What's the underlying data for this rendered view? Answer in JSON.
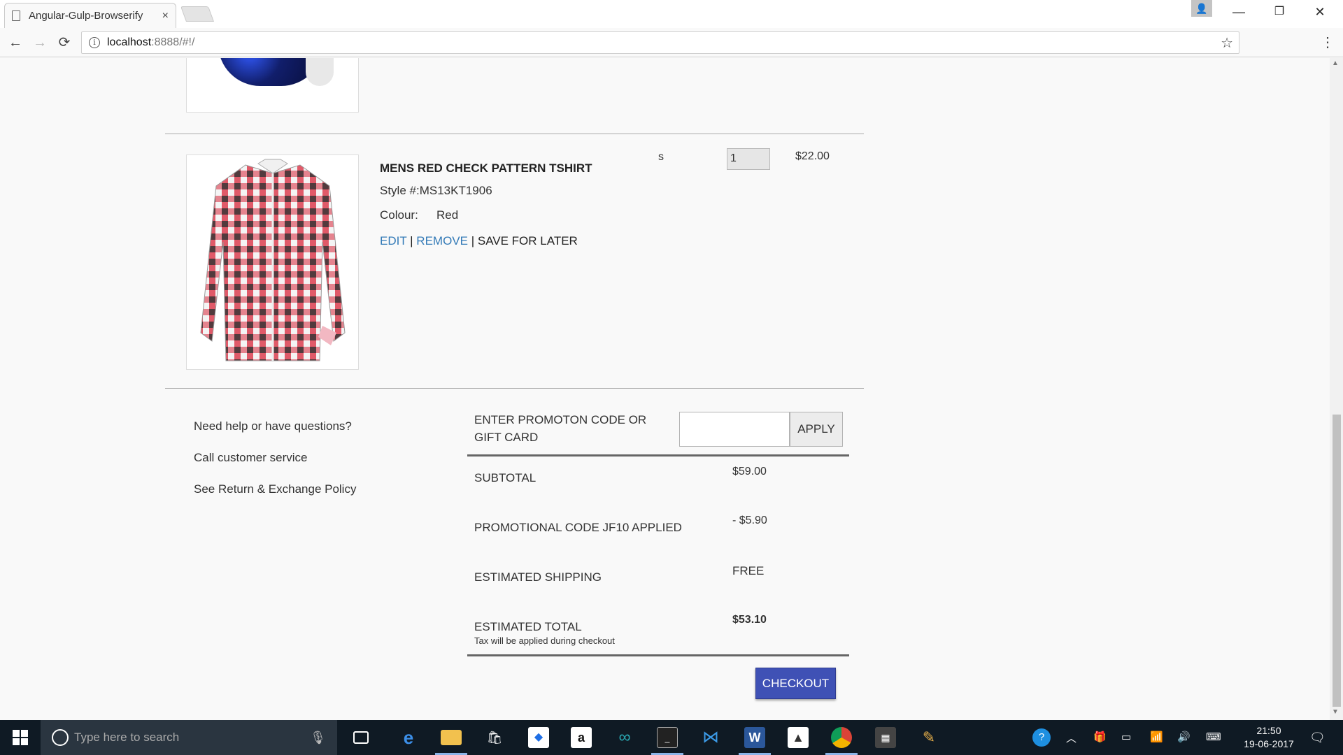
{
  "browser": {
    "tab_title": "Angular-Gulp-Browserify",
    "tab_close": "×",
    "url_host": "localhost",
    "url_rest": ":8888/#!/",
    "info_glyph": "i",
    "back_glyph": "←",
    "forward_glyph": "→",
    "reload_glyph": "⟳",
    "star_glyph": "☆",
    "menu_glyph": "⋮",
    "profile_glyph": "👤",
    "minimize_glyph": "—",
    "restore_glyph": "❐",
    "close_glyph": "✕"
  },
  "cart_item": {
    "name": "MENS RED CHECK PATTERN TSHIRT",
    "style": "Style #:MS13KT1906",
    "colour_label": "Colour:",
    "colour_value": "Red",
    "edit": "EDIT",
    "sep1": " | ",
    "remove": "REMOVE",
    "sep2": " | ",
    "save_for_later": "SAVE FOR LATER",
    "size": "s",
    "quantity": "1",
    "price": "$22.00"
  },
  "help": {
    "question": "Need help or have questions?",
    "call": "Call customer service",
    "policy": "See Return & Exchange Policy"
  },
  "promo": {
    "label": "ENTER PROMOTON CODE OR GIFT CARD",
    "input_value": "",
    "apply": "APPLY"
  },
  "summary": {
    "subtotal_label": "SUBTOTAL",
    "subtotal_value": "$59.00",
    "promo_label": "PROMOTIONAL CODE JF10 APPLIED",
    "promo_value": "- $5.90",
    "shipping_label": "ESTIMATED SHIPPING",
    "shipping_value": "FREE",
    "total_label": "ESTIMATED TOTAL",
    "total_value": "$53.10",
    "tax_note": "Tax will be applied during checkout"
  },
  "checkout": "CHECKOUT",
  "taskbar": {
    "search_placeholder": "Type here to search",
    "time": "21:50",
    "date": "19-06-2017",
    "pinned": [
      "task-view",
      "edge",
      "file-explorer",
      "store",
      "dropbox",
      "amazon",
      "arduino",
      "terminal",
      "vscode",
      "word",
      "photos",
      "chrome",
      "calculator",
      "paint"
    ]
  },
  "colors": {
    "link": "#337ab7",
    "checkout_bg": "#3f51b5",
    "taskbar_bg": "#0f1a24"
  }
}
